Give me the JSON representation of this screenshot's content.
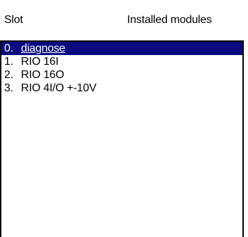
{
  "header": {
    "slot_label": "Slot",
    "modules_label": "Installed modules"
  },
  "list": {
    "items": [
      {
        "index": "0.",
        "name": "diagnose",
        "selected": true
      },
      {
        "index": "1.",
        "name": "RIO 16I",
        "selected": false
      },
      {
        "index": "2.",
        "name": "RIO 16O",
        "selected": false
      },
      {
        "index": "3.",
        "name": "RIO 4I/O +-10V",
        "selected": false
      }
    ]
  },
  "colors": {
    "selection_background": "#0a0a80",
    "selection_text": "#ffffff",
    "list_background": "#ffffff",
    "border": "#000000"
  }
}
